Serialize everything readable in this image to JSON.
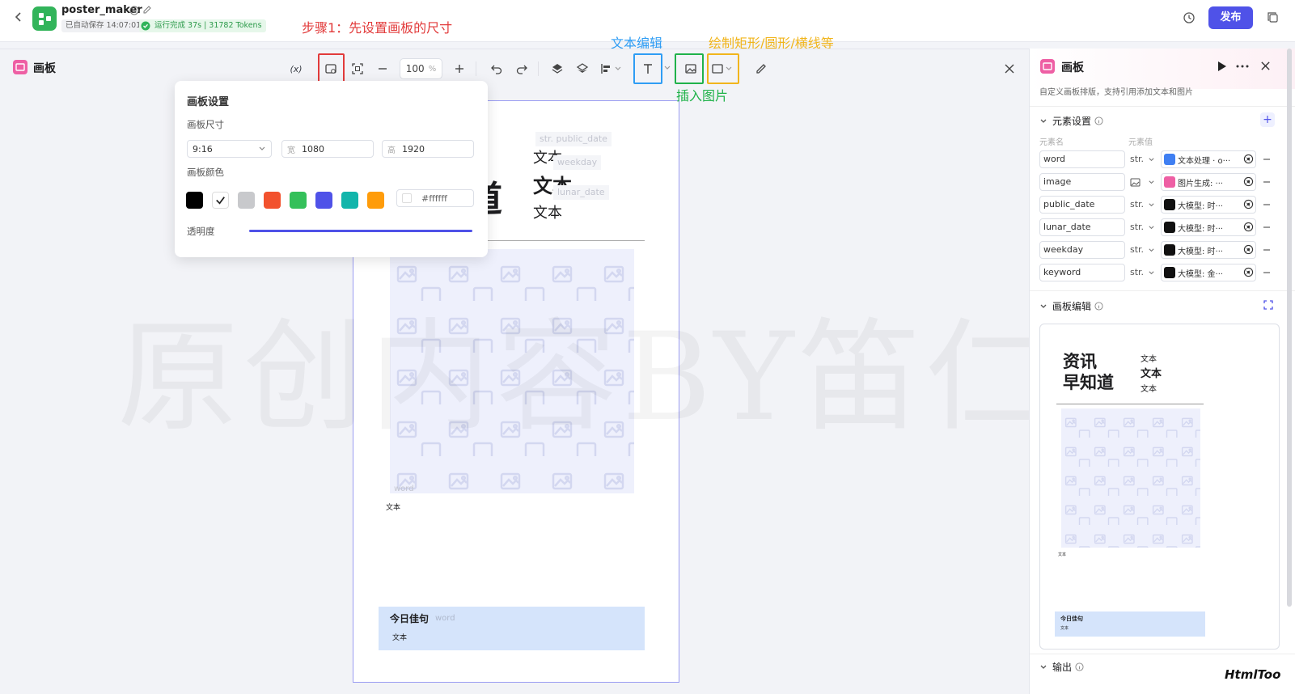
{
  "app": {
    "name": "poster_maker",
    "autosave": "已自动保存 14:07:01",
    "run_status": "运行完成 37s | 31782 Tokens",
    "publish": "发布"
  },
  "editor": {
    "title": "画板",
    "zoom": "100",
    "zoom_unit": "%",
    "var_icon": "(x)"
  },
  "annotations": {
    "step1": "步骤1：先设置画板的尺寸",
    "text_edit": "文本编辑",
    "insert_image": "插入图片",
    "draw_shapes": "绘制矩形/圆形/横线等",
    "brand": "HtmlToo"
  },
  "popup": {
    "title": "画板设置",
    "size_label": "画板尺寸",
    "ratio": "9:16",
    "width_label": "宽",
    "width": "1080",
    "height_label": "高",
    "height": "1920",
    "color_label": "画板颜色",
    "hex": "#ffffff",
    "opacity_label": "透明度",
    "colors": [
      "#000000",
      "#ffffff",
      "#c8c9cc",
      "#f2522e",
      "#34c05a",
      "#4f52e8",
      "#12b5ab",
      "#ff9c0a"
    ]
  },
  "canvas": {
    "tag_public_date": "str. public_date",
    "tag_weekday": "weekday",
    "tag_lunar": "lunar_date",
    "text1": "文本",
    "text2": "文本",
    "text3": "文本",
    "big_char": "道",
    "image_tag": "word",
    "caption": "文本",
    "quote_title": "今日佳句",
    "quote_tag": "word",
    "quote_text": "文本"
  },
  "watermark": "原创内容BY笛仁杰",
  "panel": {
    "title": "画板",
    "subtitle": "自定义画板排版，支持引用添加文本和图片",
    "elements_header": "元素设置",
    "col_name": "元素名",
    "col_value": "元素值",
    "rows": [
      {
        "name": "word",
        "type": "str.",
        "value": "文本处理 · o···",
        "icon": "blue"
      },
      {
        "name": "image",
        "type": "",
        "value": "图片生成: ···",
        "icon": "pink"
      },
      {
        "name": "public_date",
        "type": "str.",
        "value": "大模型: 时···",
        "icon": "black"
      },
      {
        "name": "lunar_date",
        "type": "str.",
        "value": "大模型: 时···",
        "icon": "black"
      },
      {
        "name": "weekday",
        "type": "str.",
        "value": "大模型: 时···",
        "icon": "black"
      },
      {
        "name": "keyword",
        "type": "str.",
        "value": "大模型: 金···",
        "icon": "black"
      }
    ],
    "canvas_edit": "画板编辑",
    "output": "输出",
    "preview": {
      "title_l1": "资讯",
      "title_l2": "早知道",
      "t1": "文本",
      "t2": "文本",
      "t3": "文本",
      "caption": "文本",
      "quote": "今日佳句",
      "quote_text": "文本"
    }
  },
  "colors": {
    "accent": "#4f52e8",
    "step_red": "#e23b3b",
    "text_blue": "#2f9df4",
    "image_green": "#20b24a",
    "shape_yellow": "#f1b51c",
    "app_green": "#32b45a"
  }
}
